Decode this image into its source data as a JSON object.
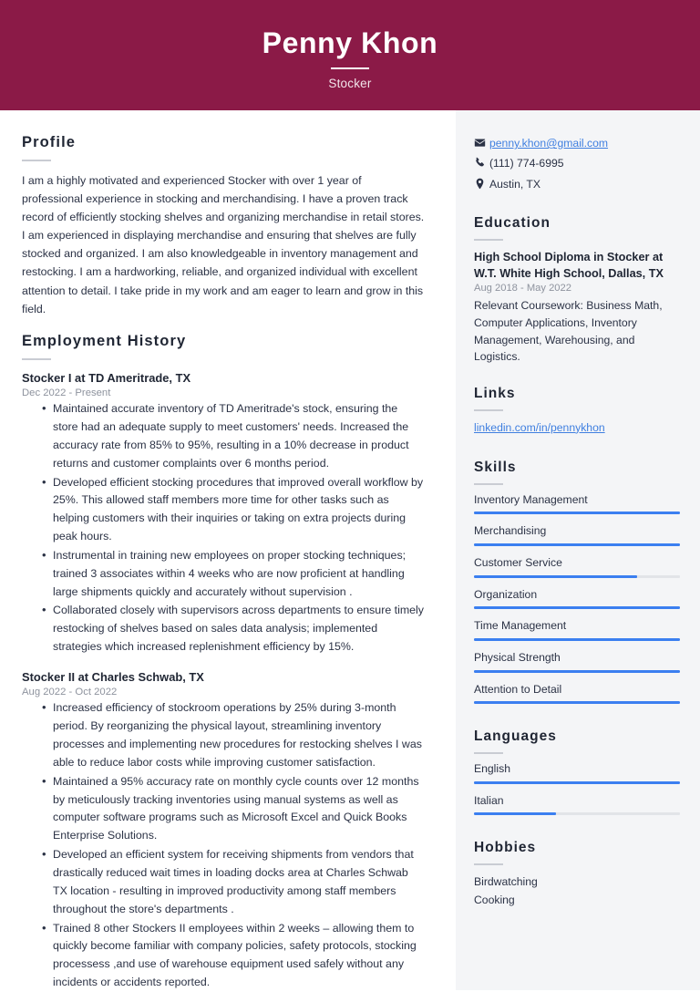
{
  "header": {
    "name": "Penny Khon",
    "role": "Stocker",
    "background_color": "#8b1a47",
    "text_color": "#ffffff"
  },
  "theme": {
    "accent": "#3b7ff0",
    "sidebar_bg": "#f4f5f7",
    "link_color": "#3f7fe0",
    "muted_text": "#8e939e",
    "bar_track": "#e2e4e8"
  },
  "main": {
    "profile": {
      "title": "Profile",
      "text": "I am a highly motivated and experienced Stocker with over 1 year of professional experience in stocking and merchandising. I have a proven track record of efficiently stocking shelves and organizing merchandise in retail stores. I am experienced in displaying merchandise and ensuring that shelves are fully stocked and organized. I am also knowledgeable in inventory management and restocking. I am a hardworking, reliable, and organized individual with excellent attention to detail. I take pride in my work and am eager to learn and grow in this field."
    },
    "employment": {
      "title": "Employment History",
      "jobs": [
        {
          "title": "Stocker I at TD Ameritrade, TX",
          "dates": "Dec 2022 - Present",
          "bullets": [
            "Maintained accurate inventory of TD Ameritrade's stock, ensuring the store had an adequate supply to meet customers' needs. Increased the accuracy rate from 85% to 95%, resulting in a 10% decrease in product returns and customer complaints over 6 months period.",
            "Developed efficient stocking procedures that improved overall workflow by 25%. This allowed staff members more time for other tasks such as helping customers with their inquiries or taking on extra projects during peak hours.",
            "Instrumental in training new employees on proper stocking techniques; trained 3 associates within 4 weeks who are now proficient at handling large shipments quickly and accurately without supervision .",
            "Collaborated closely with supervisors across departments to ensure timely restocking of shelves based on sales data analysis; implemented strategies which increased replenishment efficiency by 15%."
          ]
        },
        {
          "title": "Stocker II at Charles Schwab, TX",
          "dates": "Aug 2022 - Oct 2022",
          "bullets": [
            "Increased efficiency of stockroom operations by 25% during 3-month period. By reorganizing the physical layout, streamlining inventory processes and implementing new procedures for restocking shelves I was able to reduce labor costs while improving customer satisfaction.",
            "Maintained a 95% accuracy rate on monthly cycle counts over 12 months by meticulously tracking inventories using manual systems as well as computer software programs such as Microsoft Excel and Quick Books Enterprise Solutions.",
            "Developed an efficient system for receiving shipments from vendors that drastically reduced wait times in loading docks area at Charles Schwab TX location - resulting in improved productivity among staff members throughout the store's departments .",
            "Trained 8 other Stockers II employees within 2 weeks – allowing them to quickly become familiar with company policies, safety protocols, stocking processess ,and use of warehouse equipment used safely without any incidents or accidents reported."
          ]
        }
      ]
    }
  },
  "sidebar": {
    "contact": [
      {
        "icon": "envelope-icon",
        "value": "penny.khon@gmail.com",
        "is_link": true
      },
      {
        "icon": "phone-icon",
        "value": "(111) 774-6995",
        "is_link": false
      },
      {
        "icon": "location-pin-icon",
        "value": "Austin, TX",
        "is_link": false
      }
    ],
    "education": {
      "title": "Education",
      "entries": [
        {
          "degree": "High School Diploma in Stocker at W.T. White High School, Dallas, TX",
          "dates": "Aug 2018 - May 2022",
          "description": "Relevant Coursework: Business Math, Computer Applications, Inventory Management, Warehousing, and Logistics."
        }
      ]
    },
    "links": {
      "title": "Links",
      "items": [
        {
          "label": "linkedin.com/in/pennykhon"
        }
      ]
    },
    "skills": {
      "title": "Skills",
      "items": [
        {
          "label": "Inventory Management",
          "level": 100
        },
        {
          "label": "Merchandising",
          "level": 100
        },
        {
          "label": "Customer Service",
          "level": 79
        },
        {
          "label": "Organization",
          "level": 100
        },
        {
          "label": "Time Management",
          "level": 100
        },
        {
          "label": "Physical Strength",
          "level": 100
        },
        {
          "label": "Attention to Detail",
          "level": 100
        }
      ]
    },
    "languages": {
      "title": "Languages",
      "items": [
        {
          "label": "English",
          "level": 100
        },
        {
          "label": "Italian",
          "level": 40
        }
      ]
    },
    "hobbies": {
      "title": "Hobbies",
      "items": [
        {
          "label": "Birdwatching"
        },
        {
          "label": "Cooking"
        }
      ]
    }
  }
}
